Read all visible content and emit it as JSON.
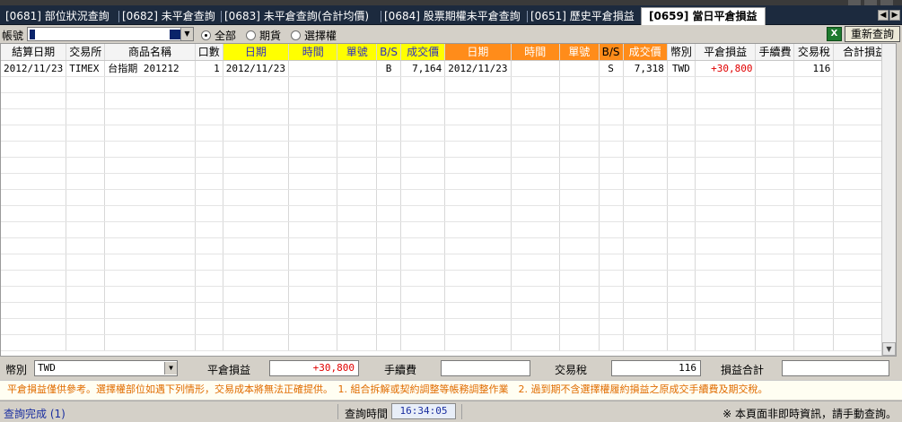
{
  "tabs": [
    {
      "label": "[0681] 部位狀況查詢"
    },
    {
      "label": "[0682] 未平倉查詢"
    },
    {
      "label": "[0683] 未平倉查詢(合計均價)"
    },
    {
      "label": "[0684] 股票期權未平倉查詢"
    },
    {
      "label": "[0651] 歷史平倉損益"
    },
    {
      "label": "[0659] 當日平倉損益"
    }
  ],
  "toolbar": {
    "account_label": "帳號",
    "filter_options": [
      {
        "label": "全部",
        "selected": true
      },
      {
        "label": "期貨",
        "selected": false
      },
      {
        "label": "選擇權",
        "selected": false
      }
    ],
    "excel_icon": "excel-icon",
    "excel_glyph": "X",
    "refresh_label": "重新查詢"
  },
  "table": {
    "headers": {
      "settle_date": "結算日期",
      "exchange": "交易所",
      "product": "商品名稱",
      "qty": "口數",
      "buy_date": "日期",
      "buy_time": "時間",
      "buy_order": "單號",
      "buy_bs": "B/S",
      "buy_price": "成交價",
      "sell_date": "日期",
      "sell_time": "時間",
      "sell_order": "單號",
      "sell_bs": "B/S",
      "sell_price": "成交價",
      "currency": "幣別",
      "pnl": "平倉損益",
      "fee": "手續費",
      "tax": "交易稅",
      "total": "合計損益"
    },
    "rows": [
      {
        "settle_date": "2012/11/23",
        "exchange": "TIMEX",
        "product": "台指期 201212",
        "qty": "1",
        "buy_date": "2012/11/23",
        "buy_time": "",
        "buy_order": "",
        "buy_bs": "B",
        "buy_price": "7,164",
        "sell_date": "2012/11/23",
        "sell_time": "",
        "sell_order": "",
        "sell_bs": "S",
        "sell_price": "7,318",
        "currency": "TWD",
        "pnl": "+30,800",
        "fee": "",
        "tax": "116",
        "total": ""
      }
    ]
  },
  "summary": {
    "currency_label": "幣別",
    "currency_value": "TWD",
    "pnl_label": "平倉損益",
    "pnl_value": "+30,800",
    "fee_label": "手續費",
    "fee_value": "",
    "tax_label": "交易稅",
    "tax_value": "116",
    "total_label": "損益合計",
    "total_value": ""
  },
  "note": "平倉損益僅供參考。選擇權部位如遇下列情形，交易成本將無法正確提供。　1. 組合拆解或契約調整等帳務調整作業　2. 過到期不含選擇權履約損益之原成交手續費及期交稅。",
  "status": {
    "message": "查詢完成 (1)",
    "query_time_label": "查詢時間",
    "query_time_value": "16:34:05",
    "warning": "※ 本頁面非即時資訊，請手動查詢。"
  },
  "colors": {
    "buy_header": "#ffff00",
    "sell_header": "#ff8c1a",
    "profit": "#e00000",
    "tabbar": "#1c2a3e"
  }
}
